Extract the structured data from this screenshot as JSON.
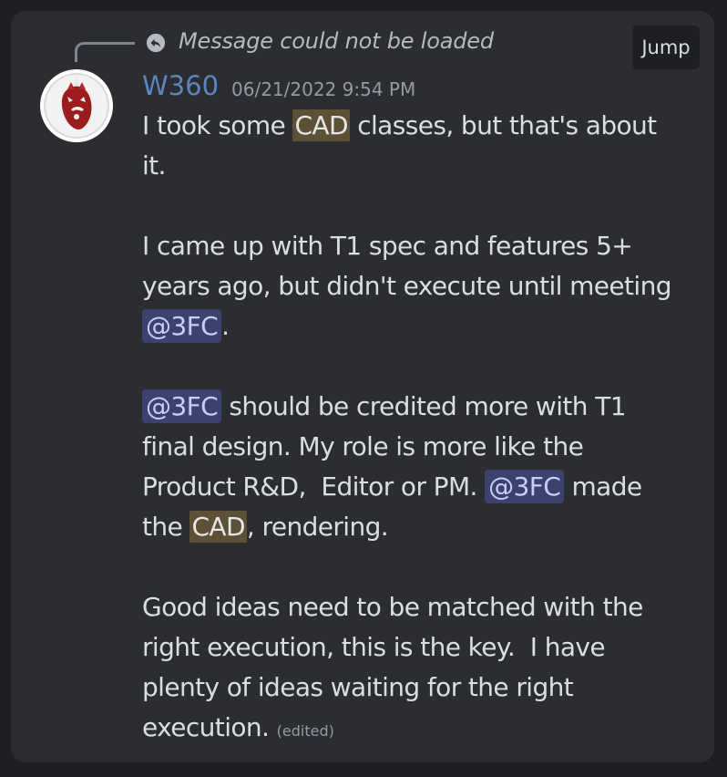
{
  "reply": {
    "text": "Message could not be loaded",
    "jump_label": "Jump"
  },
  "author": {
    "name": "W360",
    "name_color": "#5a86bd",
    "timestamp": "06/21/2022 9:54 PM",
    "avatar": "volleyball-face-avatar"
  },
  "message": {
    "p1_a": "I took some ",
    "p1_hl": "CAD",
    "p1_b": " classes, but that's about",
    "p1_c": "it.",
    "p2_a": "I came up with T1 spec and features 5+",
    "p2_b": "years ago, but didn't execute until meeting",
    "p2_mention": "@3FC",
    "p2_end": ".",
    "p3_mention1": "@3FC",
    "p3_a": " should be credited more with T1",
    "p3_b": "final design. My role is more like the",
    "p3_c": "Product R&D,  Editor or PM. ",
    "p3_mention2": "@3FC",
    "p3_d": " made",
    "p3_e": "the ",
    "p3_hl": "CAD",
    "p3_f": ", rendering.",
    "p4_a": "Good ideas need to be matched with the",
    "p4_b": "right execution, this is the key.  I have",
    "p4_c": "plenty of ideas waiting for the right",
    "p4_d": "execution. ",
    "edited": "(edited)"
  },
  "colors": {
    "background": "#1e1f22",
    "card": "#2b2d31",
    "highlight": "#5c5037",
    "mention_bg": "#3c4270",
    "mention_text": "#c9cdfb"
  }
}
